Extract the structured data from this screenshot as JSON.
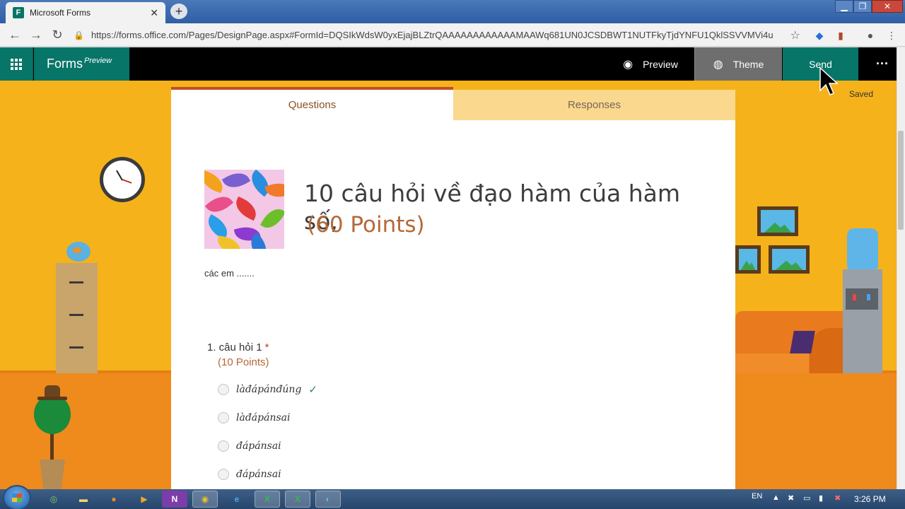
{
  "browser": {
    "tab_title": "Microsoft Forms",
    "tab_close": "✕",
    "new_tab": "+",
    "url": "https://forms.office.com/Pages/DesignPage.aspx#FormId=DQSIkWdsW0yxEjajBLZtrQAAAAAAAAAAAAMAAWq681UN0JCSDBWT1NUTFkyTjdYNFU1QklSSVVMVi4u",
    "back_icon": "←",
    "forward_icon": "→",
    "reload_icon": "↻",
    "lock_icon": "🔒",
    "star_icon": "☆",
    "menu_icon": "⋮",
    "window_min": "▁",
    "window_max": "❐",
    "window_close": "✕"
  },
  "forms_header": {
    "app_name": "Forms",
    "app_tag": "Preview",
    "preview_label": "Preview",
    "theme_label": "Theme",
    "send_label": "Send",
    "more_label": "···",
    "saved_label": "Saved"
  },
  "tabs": {
    "questions": "Questions",
    "responses": "Responses"
  },
  "form": {
    "title": "10 câu hỏi về đạo hàm của hàm số,",
    "points": "(60 Points)",
    "description": "các em ......."
  },
  "question1": {
    "number_text": "1. câu hỏi 1",
    "required_mark": "*",
    "points": "(10 Points)",
    "options": [
      {
        "label": "làđápánđúng",
        "correct": true
      },
      {
        "label": "làđápánsai",
        "correct": false
      },
      {
        "label": "đápánsai",
        "correct": false
      },
      {
        "label": "đápánsai",
        "correct": false
      }
    ],
    "check_icon": "✓"
  },
  "taskbar": {
    "lang": "EN",
    "time": "3:26 PM",
    "apps": [
      "chrome-alt",
      "explorer",
      "firefox",
      "media-player",
      "onenote",
      "chrome",
      "ie",
      "excel",
      "excel",
      "network"
    ]
  },
  "colors": {
    "brand_teal": "#077568",
    "theme_yellow": "#f5b21b",
    "accent_orange": "#b66837",
    "required_red": "#c13a24"
  }
}
